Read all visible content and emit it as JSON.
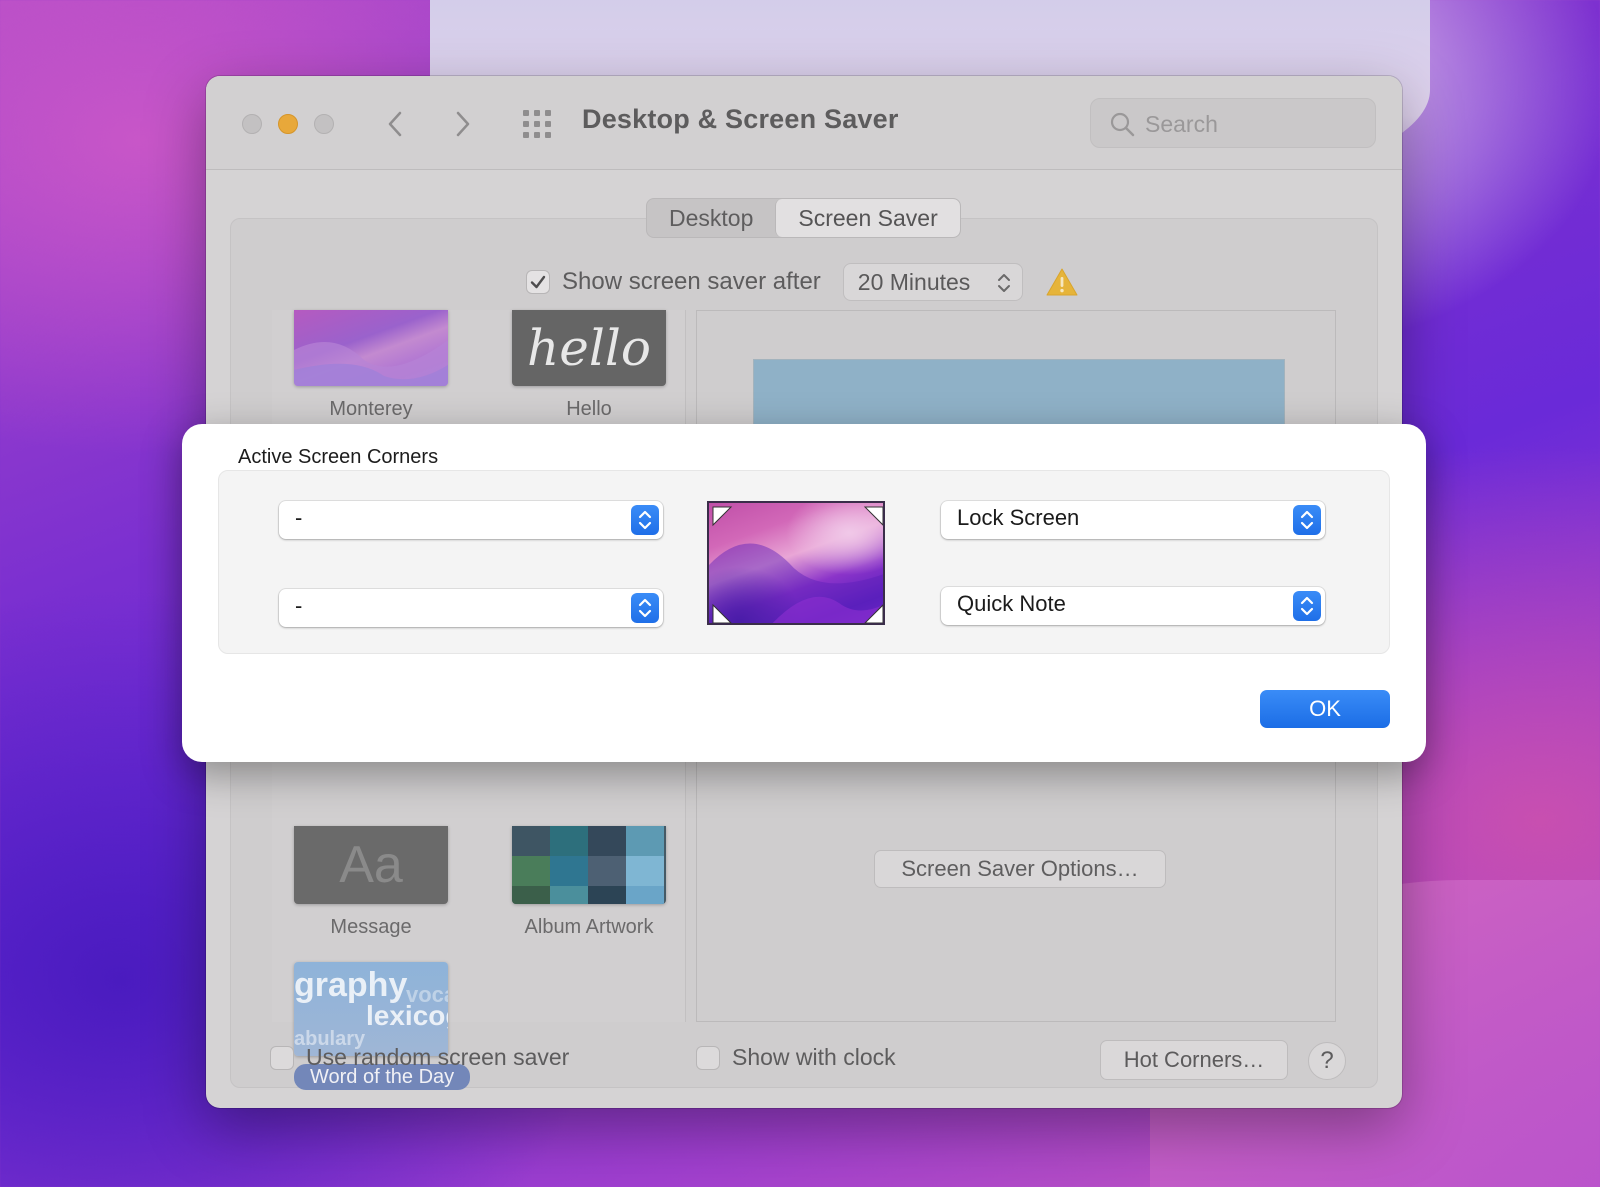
{
  "window": {
    "title": "Desktop & Screen Saver",
    "search_placeholder": "Search"
  },
  "tabs": [
    {
      "label": "Desktop",
      "active": false
    },
    {
      "label": "Screen Saver",
      "active": true
    }
  ],
  "screen_saver": {
    "show_after_label": "Show screen saver after",
    "show_after_checked": true,
    "time_value": "20 Minutes",
    "warning_icon": "warning-triangle-icon"
  },
  "thumbnails": [
    {
      "caption": "Monterey",
      "art": "monterey-gradient"
    },
    {
      "caption": "Hello",
      "art": "hello",
      "art_text": "hello"
    },
    {
      "caption": "Message",
      "art": "message",
      "art_text": "Aa"
    },
    {
      "caption": "Album Artwork",
      "art": "album-collage"
    },
    {
      "caption": "Word of the Day",
      "art": "word-of-the-day",
      "selected": true,
      "art_words": [
        "graphy",
        "voca",
        "lexicog",
        "abulary"
      ]
    }
  ],
  "options_button": "Screen Saver Options…",
  "bottom": {
    "random_label": "Use random screen saver",
    "random_checked": false,
    "clock_label": "Show with clock",
    "clock_checked": false,
    "hot_corners_button": "Hot Corners…",
    "help_button": "?"
  },
  "sheet": {
    "title": "Active Screen Corners",
    "top_left": "-",
    "bottom_left": "-",
    "top_right": "Lock Screen",
    "bottom_right": "Quick Note",
    "ok_button": "OK"
  },
  "colors": {
    "accent_blue": "#1f6fe8",
    "warning_yellow": "#e6b43a",
    "selection_pill": "#7387b9"
  }
}
